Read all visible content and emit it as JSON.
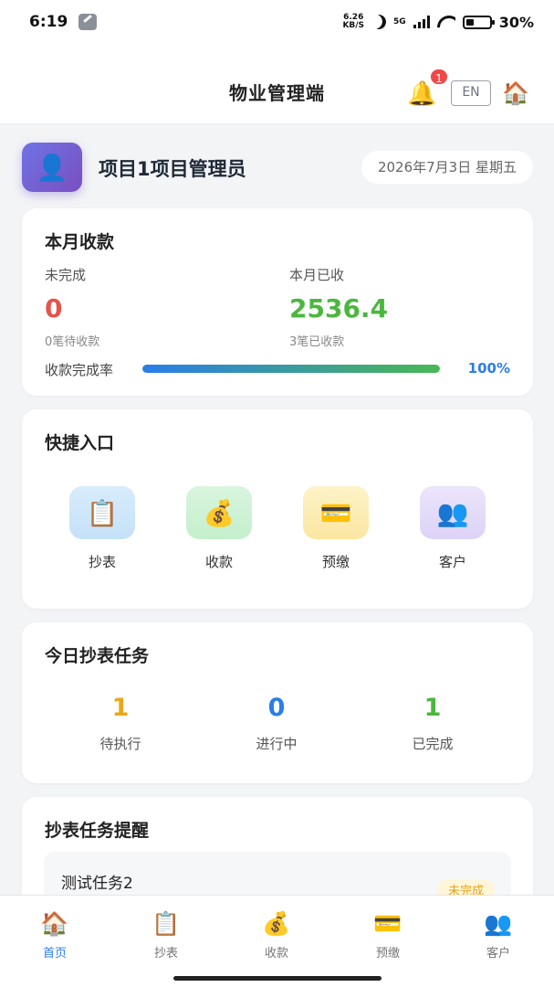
{
  "status_bar": {
    "time": "6:19",
    "net_speed_top": "6.26",
    "net_speed_bottom": "KB/S",
    "network": "5G",
    "battery": "30%"
  },
  "header": {
    "title": "物业管理端",
    "notification_count": "1",
    "lang_button": "EN"
  },
  "profile": {
    "role": "项目1项目管理员",
    "date": "2026年7月3日 星期五"
  },
  "monthly": {
    "title": "本月收款",
    "unfinished_label": "未完成",
    "unfinished_value": "0",
    "unfinished_sub": "0笔待收款",
    "received_label": "本月已收",
    "received_value": "2536.4",
    "received_sub": "3笔已收款",
    "rate_label": "收款完成率",
    "rate_value": "100%",
    "rate_fraction": 1.0
  },
  "quick": {
    "title": "快捷入口",
    "items": [
      {
        "label": "抄表",
        "icon": "clipboard-icon"
      },
      {
        "label": "收款",
        "icon": "money-bag-icon"
      },
      {
        "label": "预缴",
        "icon": "credit-card-icon"
      },
      {
        "label": "客户",
        "icon": "people-icon"
      }
    ]
  },
  "today_tasks": {
    "title": "今日抄表任务",
    "stats": [
      {
        "value": "1",
        "label": "待执行",
        "color": "#e9a81b"
      },
      {
        "value": "0",
        "label": "进行中",
        "color": "#2b7de9"
      },
      {
        "value": "1",
        "label": "已完成",
        "color": "#4cb63f"
      }
    ]
  },
  "reminders": {
    "title": "抄表任务提醒",
    "items": [
      {
        "name": "测试任务2",
        "status": "未完成"
      }
    ]
  },
  "tabbar": {
    "items": [
      {
        "label": "首页",
        "icon": "home-icon",
        "active": true
      },
      {
        "label": "抄表",
        "icon": "clipboard-icon",
        "active": false
      },
      {
        "label": "收款",
        "icon": "money-bag-icon",
        "active": false
      },
      {
        "label": "预缴",
        "icon": "credit-card-icon",
        "active": false
      },
      {
        "label": "客户",
        "icon": "people-icon",
        "active": false
      }
    ]
  },
  "colors": {
    "accent": "#2b7de9",
    "success": "#4cb63f",
    "danger": "#e5534b",
    "warning": "#e9a81b"
  }
}
